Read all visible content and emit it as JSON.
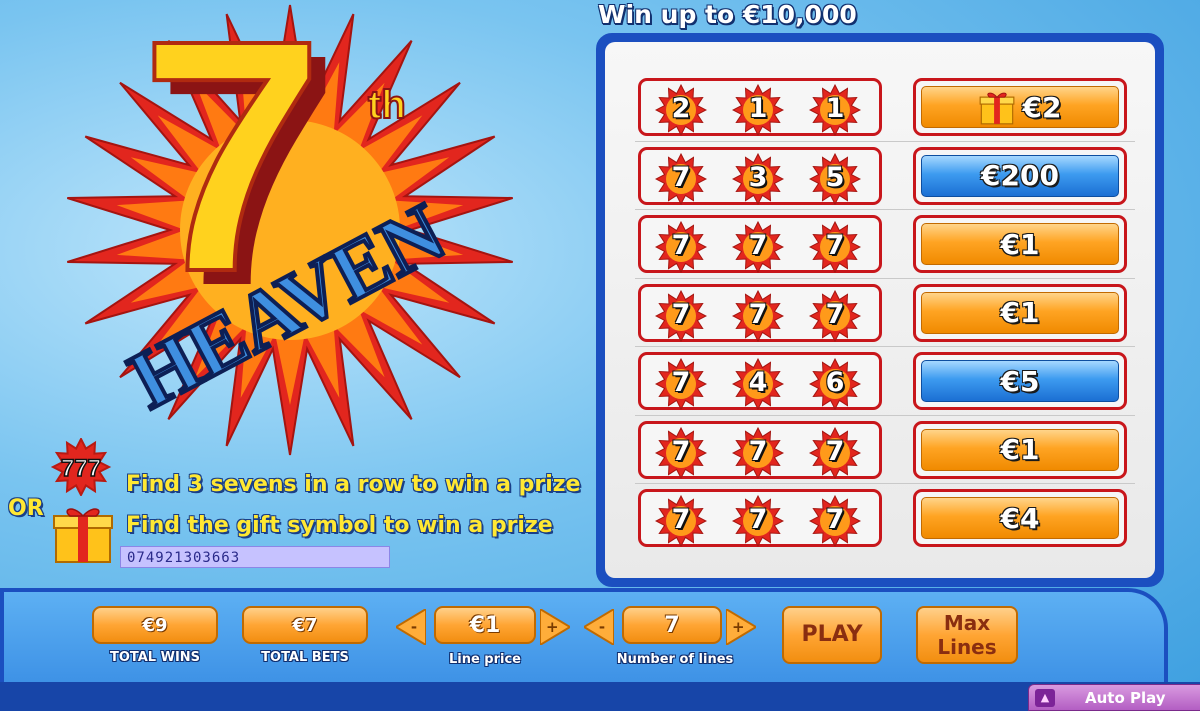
{
  "headline": "Win up to €10,000",
  "logo": {
    "number": "7",
    "suffix": "th",
    "word": "HEAVEN"
  },
  "instructions": {
    "badge": "777",
    "line1": "Find 3 sevens in a row to win a prize",
    "or": "OR",
    "line2": "Find the gift symbol to win a prize",
    "ticket_id": "074921303663"
  },
  "rows": [
    {
      "symbols": [
        "2",
        "1",
        "1"
      ],
      "prize": "€2",
      "style": "orange",
      "gift": true
    },
    {
      "symbols": [
        "7",
        "3",
        "5"
      ],
      "prize": "€200",
      "style": "blue",
      "gift": false
    },
    {
      "symbols": [
        "7",
        "7",
        "7"
      ],
      "prize": "€1",
      "style": "orange",
      "gift": false
    },
    {
      "symbols": [
        "7",
        "7",
        "7"
      ],
      "prize": "€1",
      "style": "orange",
      "gift": false
    },
    {
      "symbols": [
        "7",
        "4",
        "6"
      ],
      "prize": "€5",
      "style": "blue",
      "gift": false
    },
    {
      "symbols": [
        "7",
        "7",
        "7"
      ],
      "prize": "€1",
      "style": "orange",
      "gift": false
    },
    {
      "symbols": [
        "7",
        "7",
        "7"
      ],
      "prize": "€4",
      "style": "orange",
      "gift": false
    }
  ],
  "controls": {
    "total_wins": {
      "value": "€9",
      "label": "TOTAL WINS"
    },
    "total_bets": {
      "value": "€7",
      "label": "TOTAL BETS"
    },
    "line_price": {
      "value": "€1",
      "label": "Line price",
      "minus": "-",
      "plus": "+"
    },
    "lines": {
      "value": "7",
      "label": "Number of lines",
      "minus": "-",
      "plus": "+"
    },
    "play": "PLAY",
    "max_lines": "Max Lines",
    "auto_play": "Auto Play"
  },
  "icons": {
    "symbol": "red-starburst-icon",
    "gift": "gift-box-icon",
    "auto_play": "triangle-up-icon"
  },
  "colors": {
    "star_red": "#e2261e",
    "star_orange": "#ff9a1a",
    "prize_orange": "#ffa423",
    "prize_blue": "#3d9bf0",
    "panel_blue": "#1b4fc0"
  }
}
